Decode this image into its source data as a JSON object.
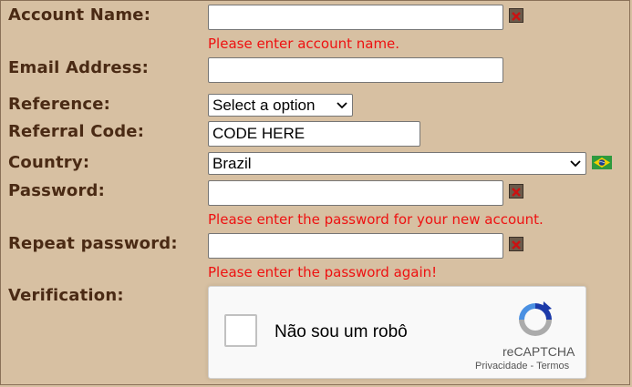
{
  "form": {
    "account_name": {
      "label": "Account Name:",
      "value": "",
      "error": "Please enter account name."
    },
    "email": {
      "label": "Email Address:",
      "value": ""
    },
    "reference": {
      "label": "Reference:",
      "selected": "Select a option"
    },
    "referral": {
      "label": "Referral Code:",
      "value": "CODE HERE"
    },
    "country": {
      "label": "Country:",
      "selected": "Brazil",
      "flag_icon": "brazil-flag-icon"
    },
    "password": {
      "label": "Password:",
      "value": "",
      "error": "Please enter the password for your new account."
    },
    "repeat_password": {
      "label": "Repeat password:",
      "value": "",
      "error": "Please enter the password again!"
    },
    "verification": {
      "label": "Verification:"
    }
  },
  "captcha": {
    "checkbox_label": "Não sou um robô",
    "brand": "reCAPTCHA",
    "privacy": "Privacidade",
    "separator": " - ",
    "terms": "Termos"
  },
  "colors": {
    "background": "#d7c0a2",
    "label": "#4a2a14",
    "error": "#ee1111"
  }
}
